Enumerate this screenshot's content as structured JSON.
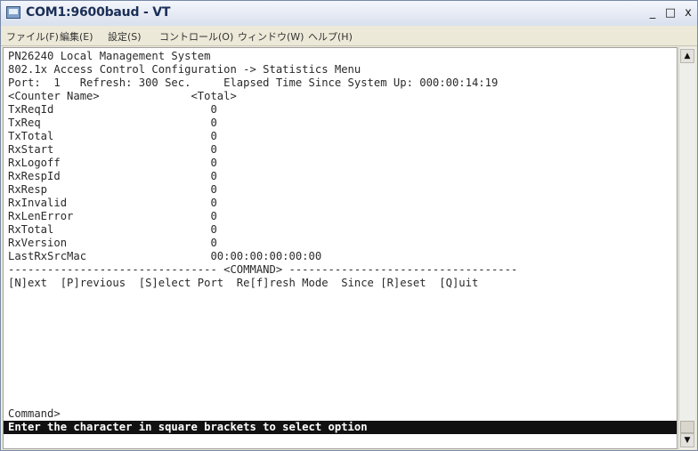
{
  "window": {
    "title": "COM1:9600baud - VT",
    "controls": {
      "minimize": "_",
      "maximize": "□",
      "close": "x"
    }
  },
  "menu": {
    "items": [
      "ファイル(F)",
      "編集(E)",
      "設定(S)",
      "コントロール(O)",
      "ウィンドウ(W)",
      "ヘルプ(H)"
    ]
  },
  "terminal": {
    "lines": [
      "PN26240 Local Management System",
      "802.1x Access Control Configuration -> Statistics Menu",
      "Port:  1   Refresh: 300 Sec.     Elapsed Time Since System Up: 000:00:14:19",
      "<Counter Name>              <Total>",
      "TxReqId                        0",
      "TxReq                          0",
      "TxTotal                        0",
      "RxStart                        0",
      "RxLogoff                       0",
      "RxRespId                       0",
      "RxResp                         0",
      "RxInvalid                      0",
      "RxLenError                     0",
      "RxTotal                        0",
      "RxVersion                      0",
      "LastRxSrcMac                   00:00:00:00:00:00",
      "-------------------------------- <COMMAND> -----------------------------------",
      "[N]ext  [P]revious  [S]elect Port  Re[f]resh Mode  Since [R]eset  [Q]uit",
      "",
      "",
      "",
      "",
      "",
      "Command>"
    ],
    "status": "Enter the character in square brackets to select option"
  },
  "scrollbar": {
    "up_arrow": "▲",
    "down_arrow": "▼"
  }
}
